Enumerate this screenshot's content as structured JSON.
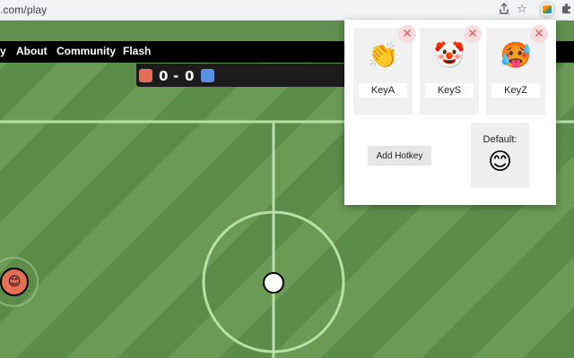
{
  "browser": {
    "url_text": ".com/play",
    "share_icon": "share-icon",
    "star_icon": "star-icon",
    "extensions_icon": "puzzle-icon",
    "overflow_text": "»"
  },
  "nav": {
    "items": [
      {
        "label": "y"
      },
      {
        "label": "About"
      },
      {
        "label": "Community"
      },
      {
        "label": "Flash"
      }
    ]
  },
  "scoreboard": {
    "red_score": "0",
    "separator": "-",
    "blue_score": "0",
    "red_color": "#e56e56",
    "blue_color": "#5b8fe5"
  },
  "players": {
    "red_player_emoji": "😊"
  },
  "popup": {
    "hotkeys": [
      {
        "emoji": "👏",
        "key": "KeyA",
        "remove": "✕"
      },
      {
        "emoji": "🤡",
        "key": "KeyS",
        "remove": "✕"
      },
      {
        "emoji": "🥵",
        "key": "KeyZ",
        "remove": "✕"
      }
    ],
    "add_button": "Add Hotkey",
    "default_label": "Default:",
    "default_emoji": "😊"
  }
}
